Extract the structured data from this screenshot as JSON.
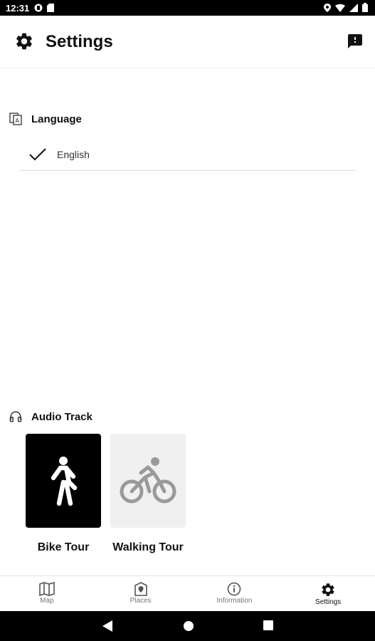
{
  "status_bar": {
    "time": "12:31"
  },
  "app_bar": {
    "title": "Settings"
  },
  "language_section": {
    "header": "Language",
    "selected_language": "English"
  },
  "audio_section": {
    "header": "Audio Track",
    "tours": [
      {
        "label": "Bike Tour",
        "icon": "walking-person-icon",
        "selected": true
      },
      {
        "label": "Walking Tour",
        "icon": "cyclist-icon",
        "selected": false
      }
    ]
  },
  "bottom_nav": {
    "items": [
      {
        "label": "Map",
        "icon": "map-icon",
        "active": false
      },
      {
        "label": "Places",
        "icon": "place-marker-icon",
        "active": false
      },
      {
        "label": "Information",
        "icon": "info-icon",
        "active": false
      },
      {
        "label": "Settings",
        "icon": "gear-icon",
        "active": true
      }
    ]
  },
  "colors": {
    "accent": "#000000",
    "unselected_card": "#f0f0f0",
    "muted_text": "#777777"
  }
}
